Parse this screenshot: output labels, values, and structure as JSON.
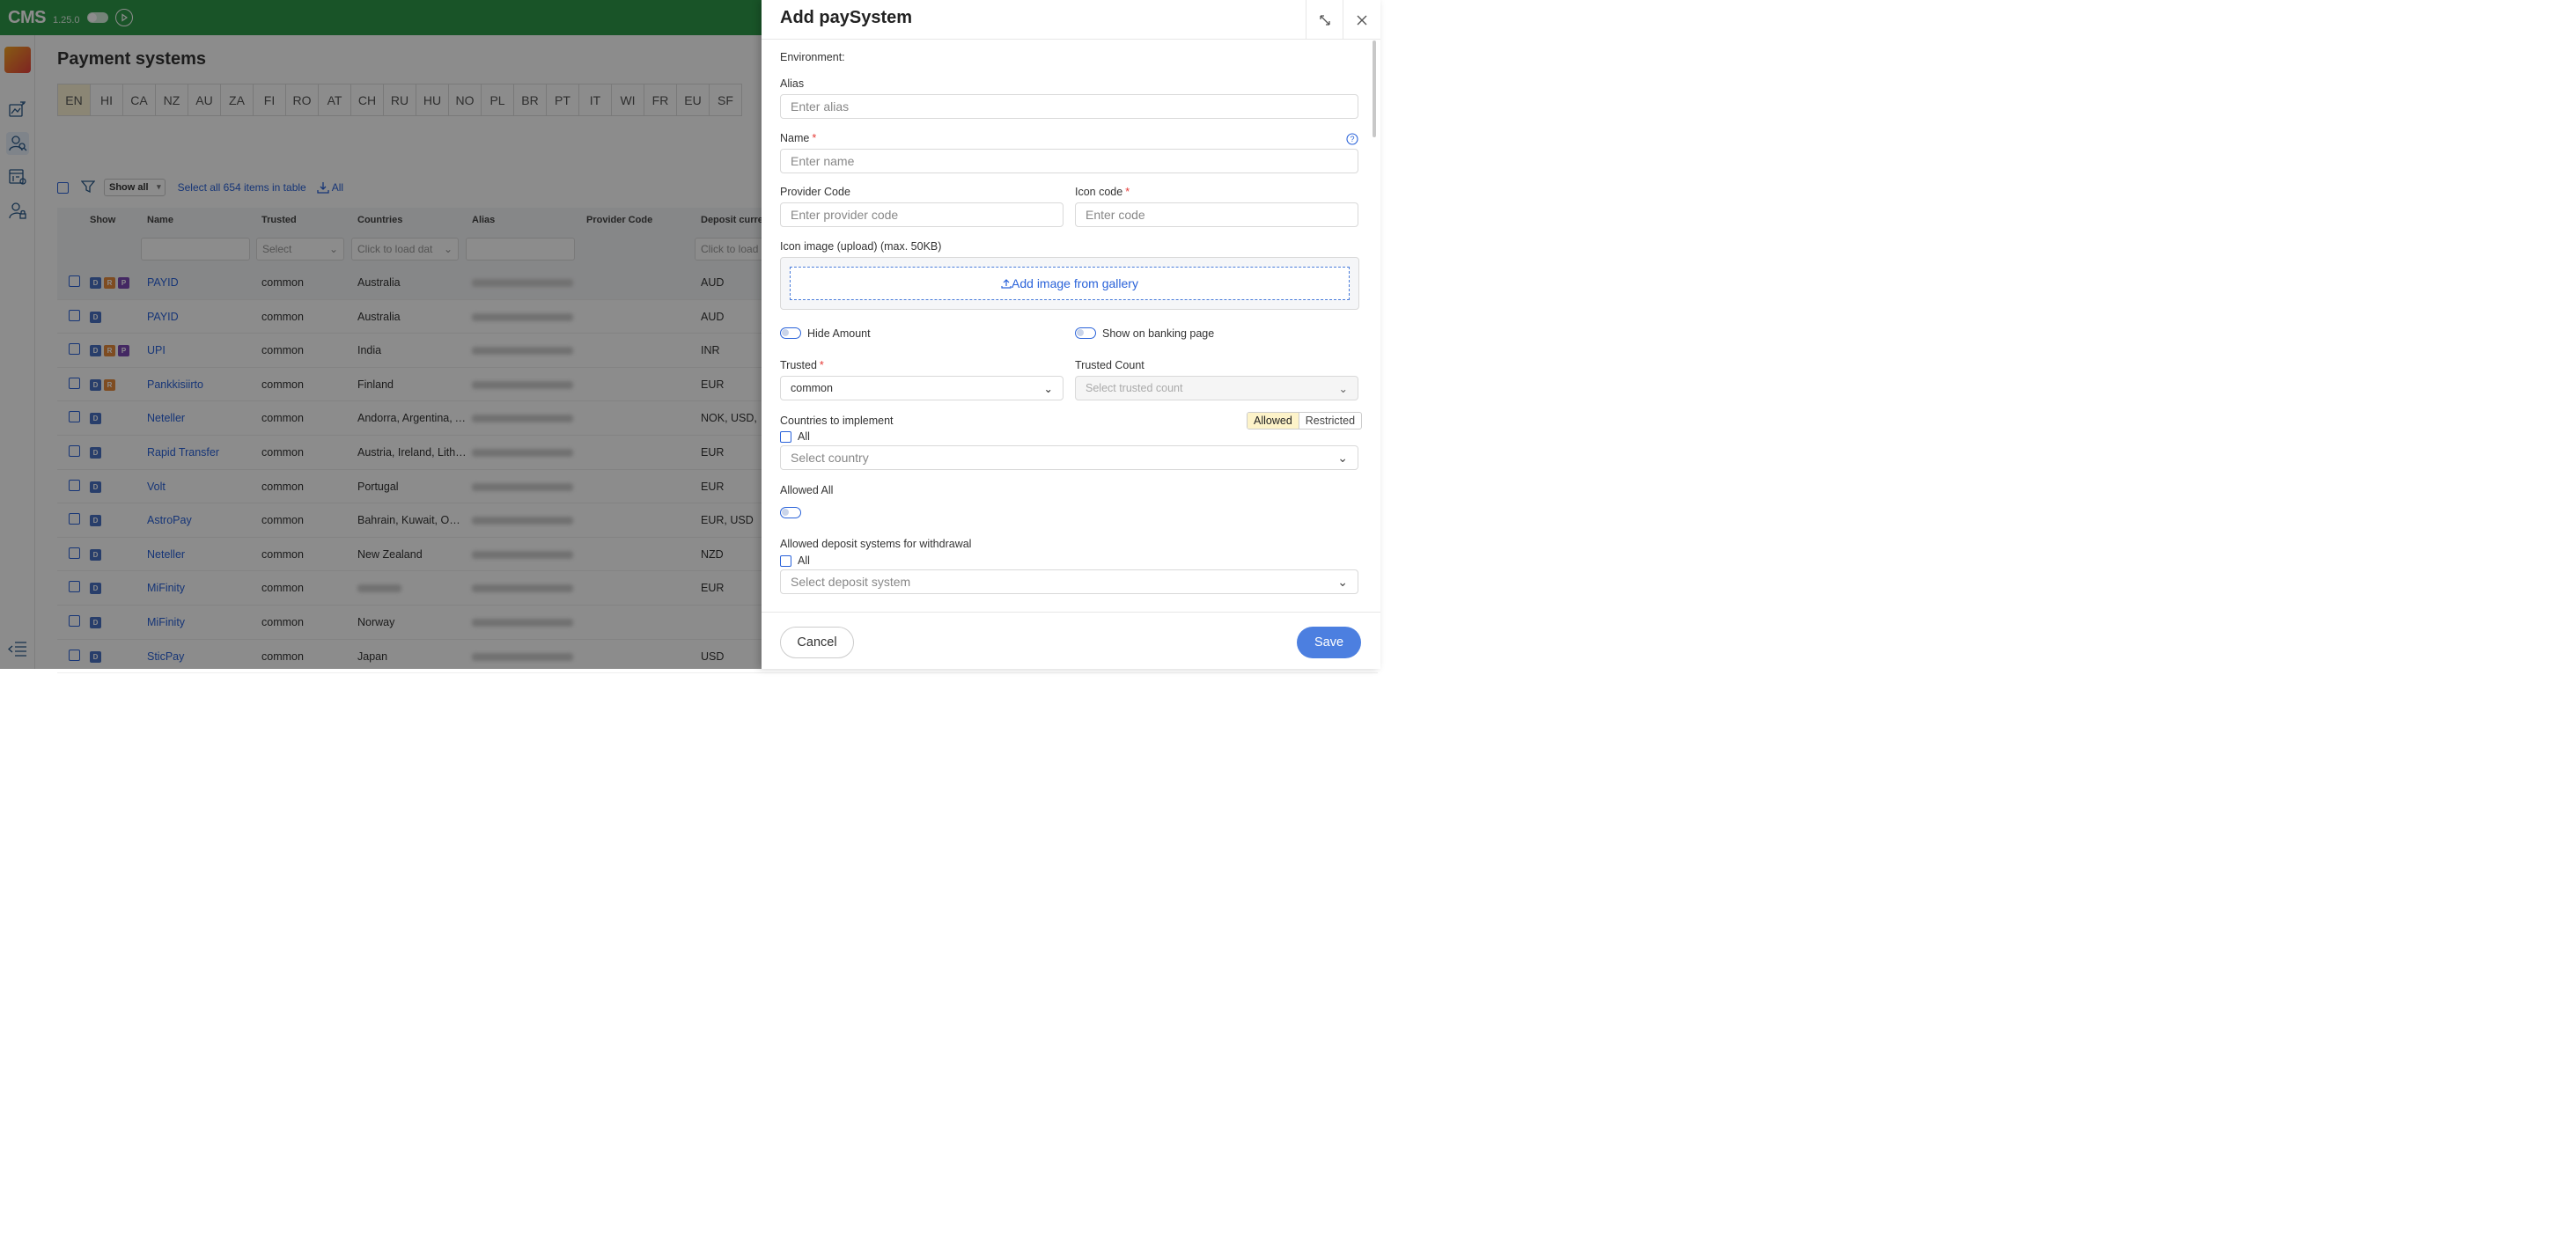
{
  "app": {
    "logo": "CMS",
    "version": "1.25.0"
  },
  "page": {
    "title": "Payment systems"
  },
  "languages": [
    "EN",
    "HI",
    "CA",
    "NZ",
    "AU",
    "ZA",
    "FI",
    "RO",
    "AT",
    "CH",
    "RU",
    "HU",
    "NO",
    "PL",
    "BR",
    "PT",
    "IT",
    "WI",
    "FR",
    "EU",
    "SF"
  ],
  "toolbar": {
    "show_all": "Show all",
    "select_all": "Select all 654 items in table",
    "all_label": "All"
  },
  "table": {
    "headers": [
      "Show",
      "Name",
      "Trusted",
      "Countries",
      "Alias",
      "Provider Code",
      "Deposit curren"
    ],
    "filters": {
      "trusted": "Select",
      "countries": "Click to load dat",
      "deposit": "Click to load"
    },
    "rows": [
      {
        "badges": [
          "D",
          "R",
          "P"
        ],
        "name": "PAYID",
        "trusted": "common",
        "countries": "Australia",
        "currency": "AUD"
      },
      {
        "badges": [
          "D"
        ],
        "name": "PAYID",
        "trusted": "common",
        "countries": "Australia",
        "currency": "AUD"
      },
      {
        "badges": [
          "D",
          "R",
          "P"
        ],
        "name": "UPI",
        "trusted": "common",
        "countries": "India",
        "currency": "INR"
      },
      {
        "badges": [
          "D",
          "R"
        ],
        "name": "Pankkisiirto",
        "trusted": "common",
        "countries": "Finland",
        "currency": "EUR"
      },
      {
        "badges": [
          "D"
        ],
        "name": "Neteller",
        "trusted": "common",
        "countries": "Andorra, Argentina, A...",
        "currency": "NOK, USD, EU"
      },
      {
        "badges": [
          "D"
        ],
        "name": "Rapid Transfer",
        "trusted": "common",
        "countries": "Austria, Ireland, Lithu...",
        "currency": "EUR"
      },
      {
        "badges": [
          "D"
        ],
        "name": "Volt",
        "trusted": "common",
        "countries": "Portugal",
        "currency": "EUR"
      },
      {
        "badges": [
          "D"
        ],
        "name": "AstroPay",
        "trusted": "common",
        "countries": "Bahrain, Kuwait, Oma...",
        "currency": "EUR, USD"
      },
      {
        "badges": [
          "D"
        ],
        "name": "Neteller",
        "trusted": "common",
        "countries": "New Zealand",
        "currency": "NZD"
      },
      {
        "badges": [
          "D"
        ],
        "name": "MiFinity",
        "trusted": "common",
        "countries": "",
        "currency": "EUR"
      },
      {
        "badges": [
          "D"
        ],
        "name": "MiFinity",
        "trusted": "common",
        "countries": "Norway",
        "currency": ""
      },
      {
        "badges": [
          "D"
        ],
        "name": "SticPay",
        "trusted": "common",
        "countries": "Japan",
        "currency": "USD"
      }
    ]
  },
  "drawer": {
    "title": "Add paySystem",
    "environment_label": "Environment:",
    "alias": {
      "label": "Alias",
      "placeholder": "Enter alias"
    },
    "name": {
      "label": "Name",
      "required": "*",
      "placeholder": "Enter name"
    },
    "provider_code": {
      "label": "Provider Code",
      "placeholder": "Enter provider code"
    },
    "icon_code": {
      "label": "Icon code",
      "required": "*",
      "placeholder": "Enter code"
    },
    "icon_image": {
      "label": "Icon image (upload) (max. 50KB)",
      "button": "Add image from gallery"
    },
    "hide_amount": {
      "label": "Hide Amount"
    },
    "show_on_banking": {
      "label": "Show on banking page"
    },
    "trusted": {
      "label": "Trusted",
      "required": "*",
      "value": "common"
    },
    "trusted_count": {
      "label": "Trusted Count",
      "placeholder": "Select trusted count"
    },
    "countries": {
      "label": "Countries to implement",
      "allowed": "Allowed",
      "restricted": "Restricted",
      "all": "All",
      "placeholder": "Select country"
    },
    "allowed_all": {
      "label": "Allowed All"
    },
    "deposit_systems": {
      "label": "Allowed deposit systems for withdrawal",
      "all": "All",
      "placeholder": "Select deposit system"
    },
    "cancel": "Cancel",
    "save": "Save"
  },
  "colors": {
    "topbar": "#2f9a49",
    "accent": "#2962d9",
    "save": "#4c7fe0"
  }
}
